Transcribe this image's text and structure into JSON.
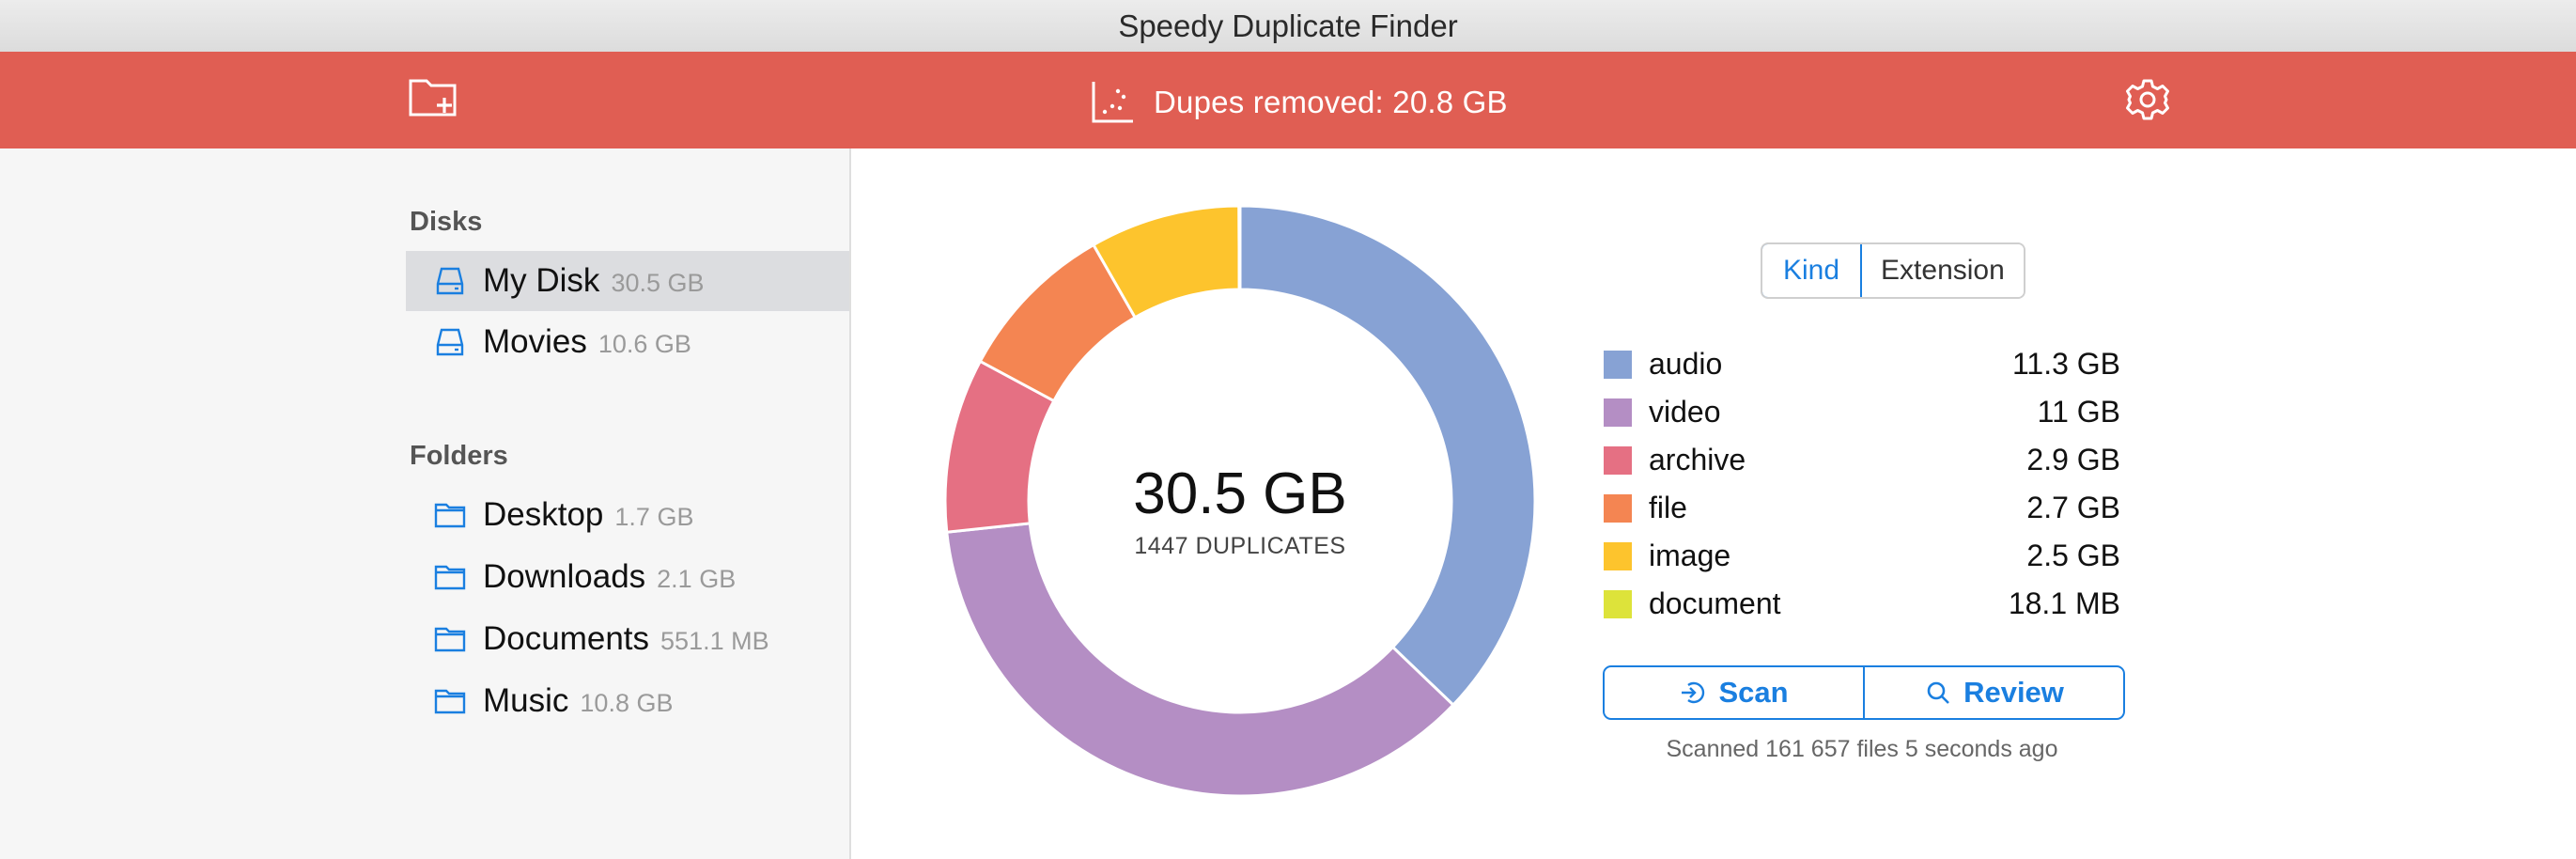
{
  "window": {
    "title": "Speedy Duplicate Finder"
  },
  "toolbar": {
    "add_folder_icon": "folder-plus-icon",
    "stat_icon": "scatter-chart-icon",
    "stat_text": "Dupes removed: 20.8 GB",
    "settings_icon": "gear-icon",
    "background": "#e05e53"
  },
  "sidebar": {
    "disks_header": "Disks",
    "disks": [
      {
        "name": "My Disk",
        "size": "30.5 GB",
        "selected": true
      },
      {
        "name": "Movies",
        "size": "10.6 GB",
        "selected": false
      }
    ],
    "folders_header": "Folders",
    "folders": [
      {
        "name": "Desktop",
        "size": "1.7 GB"
      },
      {
        "name": "Downloads",
        "size": "2.1 GB"
      },
      {
        "name": "Documents",
        "size": "551.1 MB"
      },
      {
        "name": "Music",
        "size": "10.8 GB"
      }
    ]
  },
  "summary": {
    "total": "30.5 GB",
    "duplicates": "1447 DUPLICATES"
  },
  "view_toggle": {
    "kind": "Kind",
    "extension": "Extension",
    "active": "Kind"
  },
  "legend": [
    {
      "label": "audio",
      "value": "11.3 GB",
      "color": "#87a2d4"
    },
    {
      "label": "video",
      "value": "11 GB",
      "color": "#b48ec4"
    },
    {
      "label": "archive",
      "value": "2.9 GB",
      "color": "#e57083"
    },
    {
      "label": "file",
      "value": "2.7 GB",
      "color": "#f48552"
    },
    {
      "label": "image",
      "value": "2.5 GB",
      "color": "#fdc42d"
    },
    {
      "label": "document",
      "value": "18.1 MB",
      "color": "#dde33a"
    }
  ],
  "chart_data": {
    "type": "pie",
    "variant": "donut",
    "categories": [
      "audio",
      "video",
      "archive",
      "file",
      "image",
      "document"
    ],
    "values": [
      11.3,
      11.0,
      2.9,
      2.7,
      2.5,
      0.0181
    ],
    "unit": "GB",
    "colors": [
      "#87a2d4",
      "#b48ec4",
      "#e57083",
      "#f48552",
      "#fdc42d",
      "#dde33a"
    ]
  },
  "actions": {
    "scan": "Scan",
    "review": "Review"
  },
  "status": "Scanned 161 657 files 5 seconds ago"
}
